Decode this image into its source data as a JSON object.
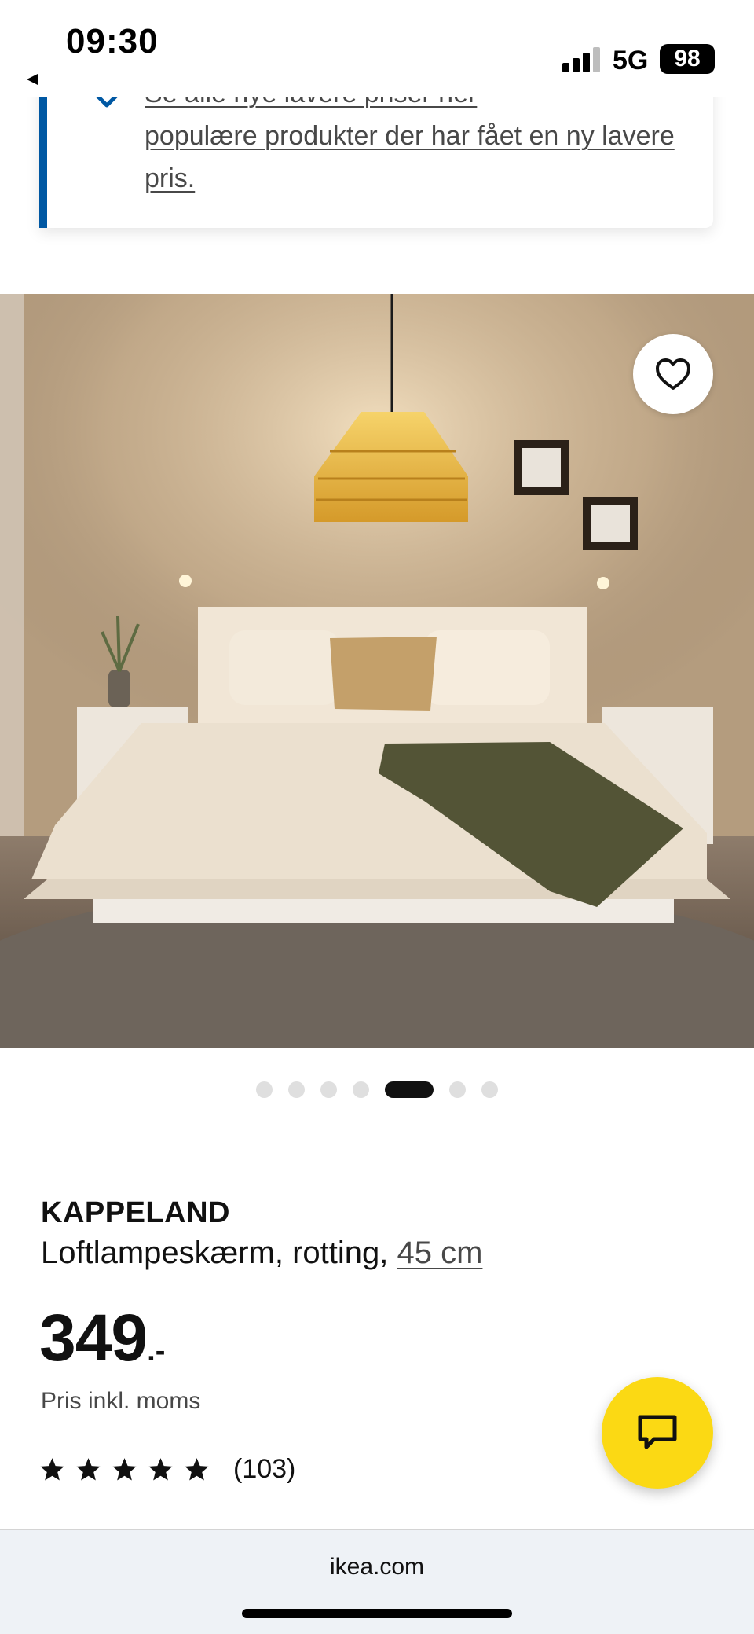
{
  "status_bar": {
    "time": "09:30",
    "network": "5G",
    "battery": "98"
  },
  "banner": {
    "text_hidden_line": "Se alle nye lavere priser her",
    "text": "populære produkter der har fået en ny lavere pris.",
    "icon": "price-tag-icon",
    "accent_color": "#0058a3"
  },
  "gallery": {
    "favorite_icon": "heart-outline-icon",
    "dots_count": 7,
    "active_index": 4
  },
  "product": {
    "name": "KAPPELAND",
    "description": "Loftlampeskærm, rotting, ",
    "size_link": "45 cm",
    "price": "349",
    "price_suffix": ".-",
    "price_note": "Pris inkl. moms",
    "rating": 5,
    "review_count": "(103)"
  },
  "chat": {
    "icon": "chat-bubble-icon",
    "color": "#fbd914"
  },
  "browser": {
    "url": "ikea.com"
  }
}
